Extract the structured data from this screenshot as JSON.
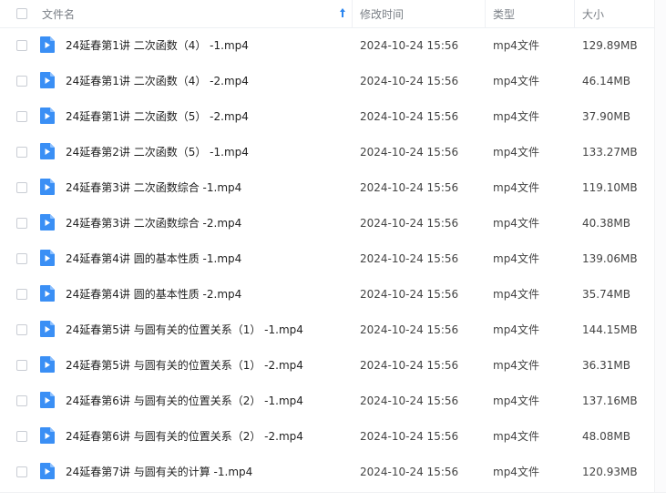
{
  "header": {
    "name_label": "文件名",
    "time_label": "修改时间",
    "type_label": "类型",
    "size_label": "大小"
  },
  "files": [
    {
      "name": "24延春第1讲 二次函数（4） -1.mp4",
      "time": "2024-10-24 15:56",
      "type": "mp4文件",
      "size": "129.89MB"
    },
    {
      "name": "24延春第1讲 二次函数（4） -2.mp4",
      "time": "2024-10-24 15:56",
      "type": "mp4文件",
      "size": "46.14MB"
    },
    {
      "name": "24延春第1讲 二次函数（5） -2.mp4",
      "time": "2024-10-24 15:56",
      "type": "mp4文件",
      "size": "37.90MB"
    },
    {
      "name": "24延春第2讲 二次函数（5） -1.mp4",
      "time": "2024-10-24 15:56",
      "type": "mp4文件",
      "size": "133.27MB"
    },
    {
      "name": "24延春第3讲 二次函数综合 -1.mp4",
      "time": "2024-10-24 15:56",
      "type": "mp4文件",
      "size": "119.10MB"
    },
    {
      "name": "24延春第3讲 二次函数综合 -2.mp4",
      "time": "2024-10-24 15:56",
      "type": "mp4文件",
      "size": "40.38MB"
    },
    {
      "name": "24延春第4讲 圆的基本性质 -1.mp4",
      "time": "2024-10-24 15:56",
      "type": "mp4文件",
      "size": "139.06MB"
    },
    {
      "name": "24延春第4讲 圆的基本性质 -2.mp4",
      "time": "2024-10-24 15:56",
      "type": "mp4文件",
      "size": "35.74MB"
    },
    {
      "name": "24延春第5讲 与圆有关的位置关系（1） -1.mp4",
      "time": "2024-10-24 15:56",
      "type": "mp4文件",
      "size": "144.15MB"
    },
    {
      "name": "24延春第5讲 与圆有关的位置关系（1） -2.mp4",
      "time": "2024-10-24 15:56",
      "type": "mp4文件",
      "size": "36.31MB"
    },
    {
      "name": "24延春第6讲 与圆有关的位置关系（2） -1.mp4",
      "time": "2024-10-24 15:56",
      "type": "mp4文件",
      "size": "137.16MB"
    },
    {
      "name": "24延春第6讲 与圆有关的位置关系（2） -2.mp4",
      "time": "2024-10-24 15:56",
      "type": "mp4文件",
      "size": "48.08MB"
    },
    {
      "name": "24延春第7讲 与圆有关的计算 -1.mp4",
      "time": "2024-10-24 15:56",
      "type": "mp4文件",
      "size": "120.93MB"
    }
  ],
  "colors": {
    "icon_blue": "#3a8ff5",
    "sort_blue": "#2b86f0"
  },
  "icons": {
    "file": "video-file-icon",
    "sort": "sort-ascending-arrow-icon"
  }
}
